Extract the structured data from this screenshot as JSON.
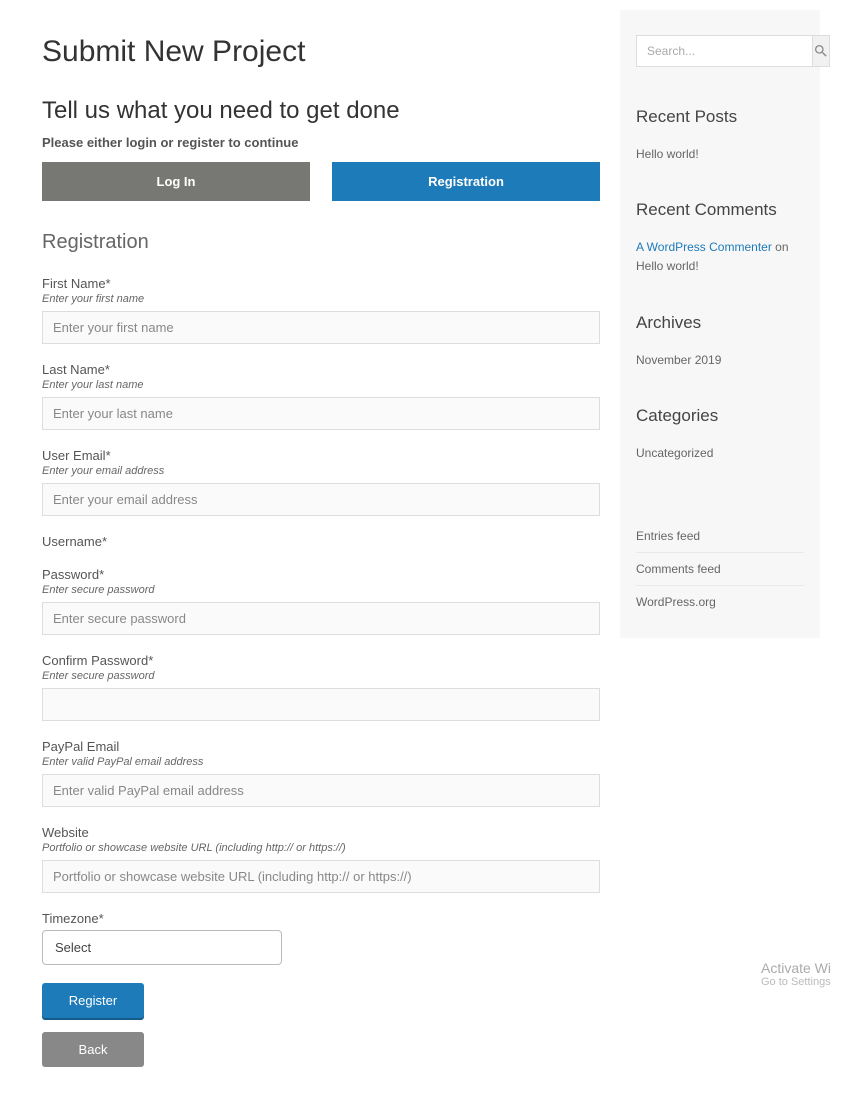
{
  "header": {
    "page_title": "Submit New Project",
    "sub_title": "Tell us what you need to get done",
    "instruction": "Please either login or register to continue",
    "tab_login": "Log In",
    "tab_register": "Registration"
  },
  "form": {
    "section_title": "Registration",
    "fields": {
      "first_name": {
        "label": "First Name*",
        "help": "Enter your first name",
        "placeholder": "Enter your first name"
      },
      "last_name": {
        "label": "Last Name*",
        "help": "Enter your last name",
        "placeholder": "Enter your last name"
      },
      "user_email": {
        "label": "User Email*",
        "help": "Enter your email address",
        "placeholder": "Enter your email address"
      },
      "username": {
        "label": "Username*"
      },
      "password": {
        "label": "Password*",
        "help": "Enter secure password",
        "placeholder": "Enter secure password"
      },
      "confirm_password": {
        "label": "Confirm Password*",
        "help": "Enter secure password"
      },
      "paypal_email": {
        "label": "PayPal Email",
        "help": "Enter valid PayPal email address",
        "placeholder": "Enter valid PayPal email address"
      },
      "website": {
        "label": "Website",
        "help": "Portfolio or showcase website URL (including http:// or https://)",
        "placeholder": "Portfolio or showcase website URL (including http:// or https://)"
      },
      "timezone": {
        "label": "Timezone*",
        "selected": "Select"
      }
    },
    "buttons": {
      "register": "Register",
      "back": "Back"
    }
  },
  "sidebar": {
    "search_placeholder": "Search...",
    "widgets": {
      "recent_posts": {
        "title": "Recent Posts",
        "item": "Hello world!"
      },
      "recent_comments": {
        "title": "Recent Comments",
        "commenter": "A WordPress Commenter",
        "on": " on Hello world!"
      },
      "archives": {
        "title": "Archives",
        "item": "November 2019"
      },
      "categories": {
        "title": "Categories",
        "item": "Uncategorized"
      }
    },
    "meta": {
      "entries_feed": "Entries feed",
      "comments_feed": "Comments feed",
      "wp_org": "WordPress.org"
    }
  },
  "watermark": {
    "line1": "Activate Wi",
    "line2": "Go to Settings"
  }
}
